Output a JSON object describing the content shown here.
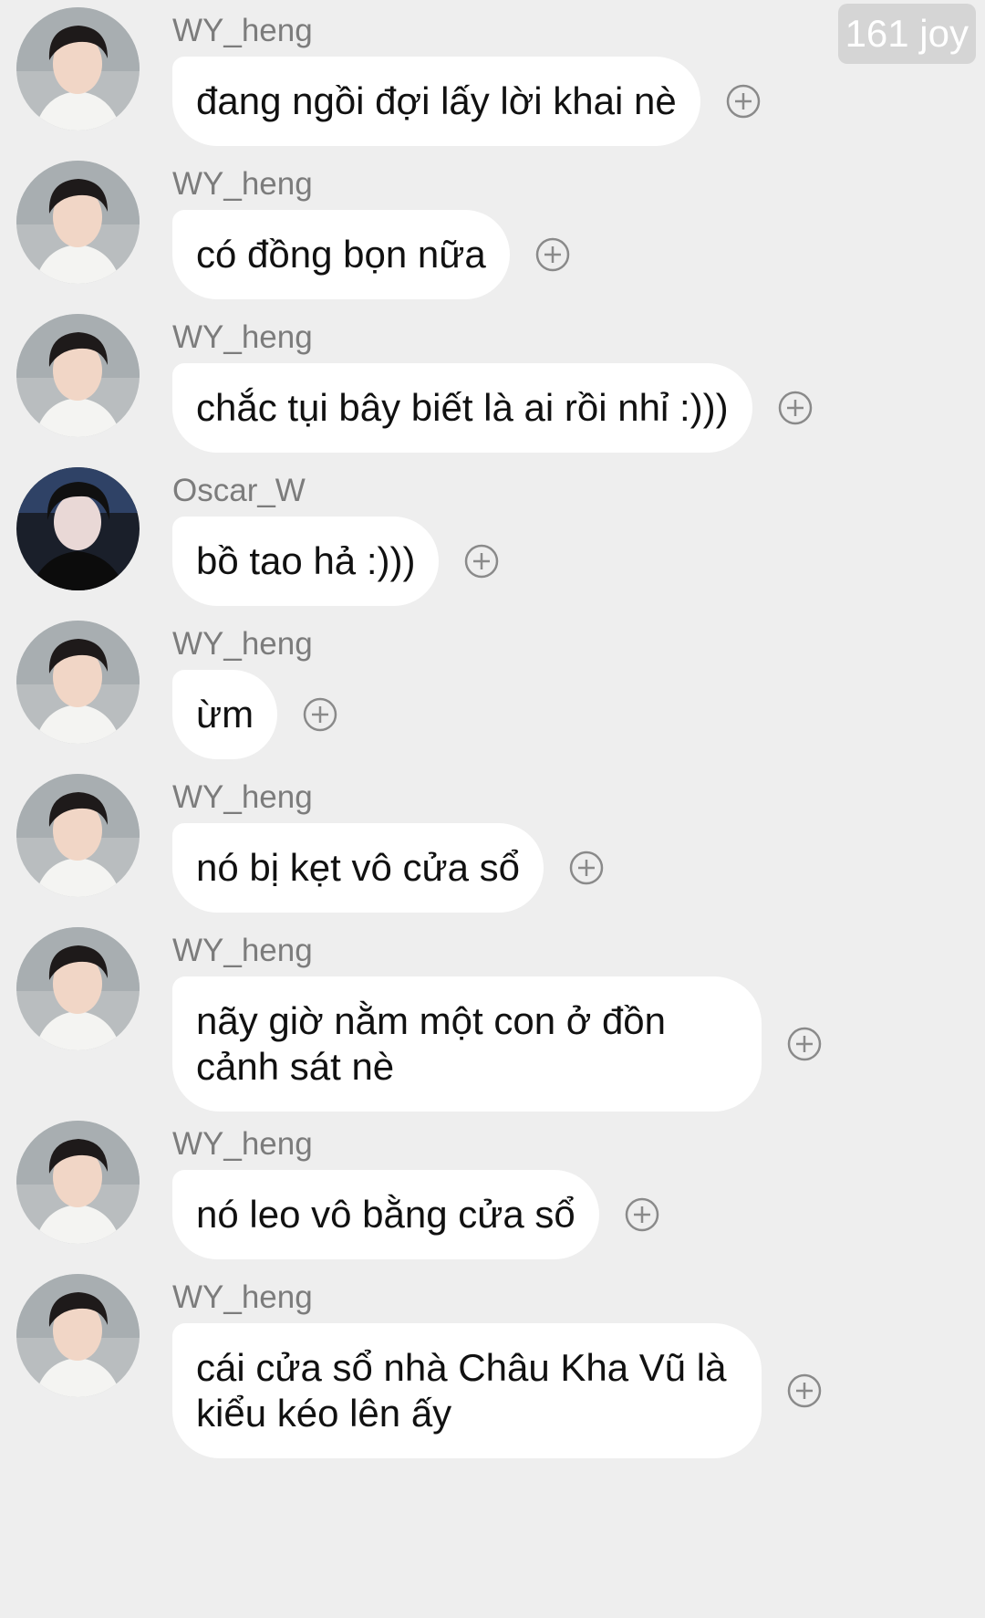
{
  "watermark": "161 joy",
  "messages": [
    {
      "sender": "WY_heng",
      "avatar": "avatar-wy-heng",
      "text": "đang ngồi đợi lấy lời khai nè"
    },
    {
      "sender": "WY_heng",
      "avatar": "avatar-wy-heng",
      "text": "có đồng bọn nữa"
    },
    {
      "sender": "WY_heng",
      "avatar": "avatar-wy-heng",
      "text": "chắc tụi bây biết là ai rồi nhỉ :)))"
    },
    {
      "sender": "Oscar_W",
      "avatar": "avatar-oscar-w",
      "text": "bồ tao hả :)))"
    },
    {
      "sender": "WY_heng",
      "avatar": "avatar-wy-heng",
      "text": "ừm"
    },
    {
      "sender": "WY_heng",
      "avatar": "avatar-wy-heng",
      "text": "nó bị kẹt vô cửa sổ"
    },
    {
      "sender": "WY_heng",
      "avatar": "avatar-wy-heng",
      "text": "nãy giờ nằm một con ở đồn\ncảnh sát nè"
    },
    {
      "sender": "WY_heng",
      "avatar": "avatar-wy-heng",
      "text": "nó leo vô bằng cửa sổ"
    },
    {
      "sender": "WY_heng",
      "avatar": "avatar-wy-heng",
      "text": "cái cửa sổ nhà Châu Kha Vũ là\nkiểu kéo lên ấy"
    }
  ],
  "colors": {
    "background": "#eeeeee",
    "bubble": "#ffffff",
    "name_text": "#7c7c7c",
    "icon": "#8a8a8a"
  },
  "icons": {
    "reaction": "plus-circle-icon"
  }
}
